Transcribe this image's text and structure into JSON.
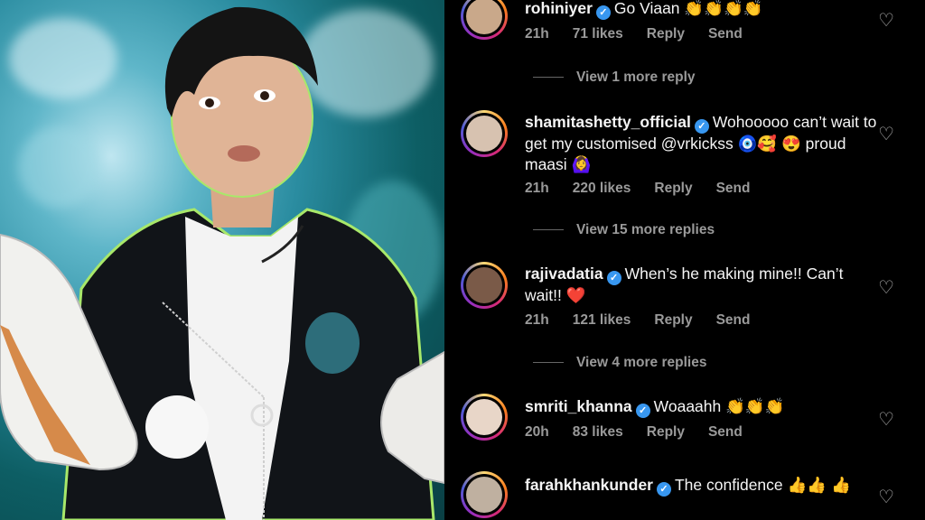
{
  "comments": [
    {
      "username": "rohiniyer",
      "text": "Go Viaan 👏👏👏👏",
      "time": "21h",
      "likes": "71 likes",
      "reply": "Reply",
      "send": "Send",
      "color": "#c9a88a"
    },
    {
      "username": "shamitashetty_official",
      "text": "Wohooooo can’t wait to get my customised @vrkickss 🧿🥰 😍 proud maasi 🙆‍♀️",
      "time": "21h",
      "likes": "220 likes",
      "reply": "Reply",
      "send": "Send",
      "color": "#d7c2b0"
    },
    {
      "username": "rajivadatia",
      "text": "When’s he making mine!! Can’t wait!! ❤️",
      "time": "21h",
      "likes": "121 likes",
      "reply": "Reply",
      "send": "Send",
      "color": "#7a5a48"
    },
    {
      "username": "smriti_khanna",
      "text": "Woaaahh 👏👏👏",
      "time": "20h",
      "likes": "83 likes",
      "reply": "Reply",
      "send": "Send",
      "color": "#e8d6c8"
    },
    {
      "username": "farahkhankunder",
      "text": "The confidence 👍👍 👍",
      "color": "#bfb0a0"
    }
  ],
  "view_more": [
    "View 1 more reply",
    "View 15 more replies",
    "View 4 more replies"
  ],
  "icons": {
    "verified": "verified-badge-icon",
    "like": "heart-outline-icon"
  }
}
